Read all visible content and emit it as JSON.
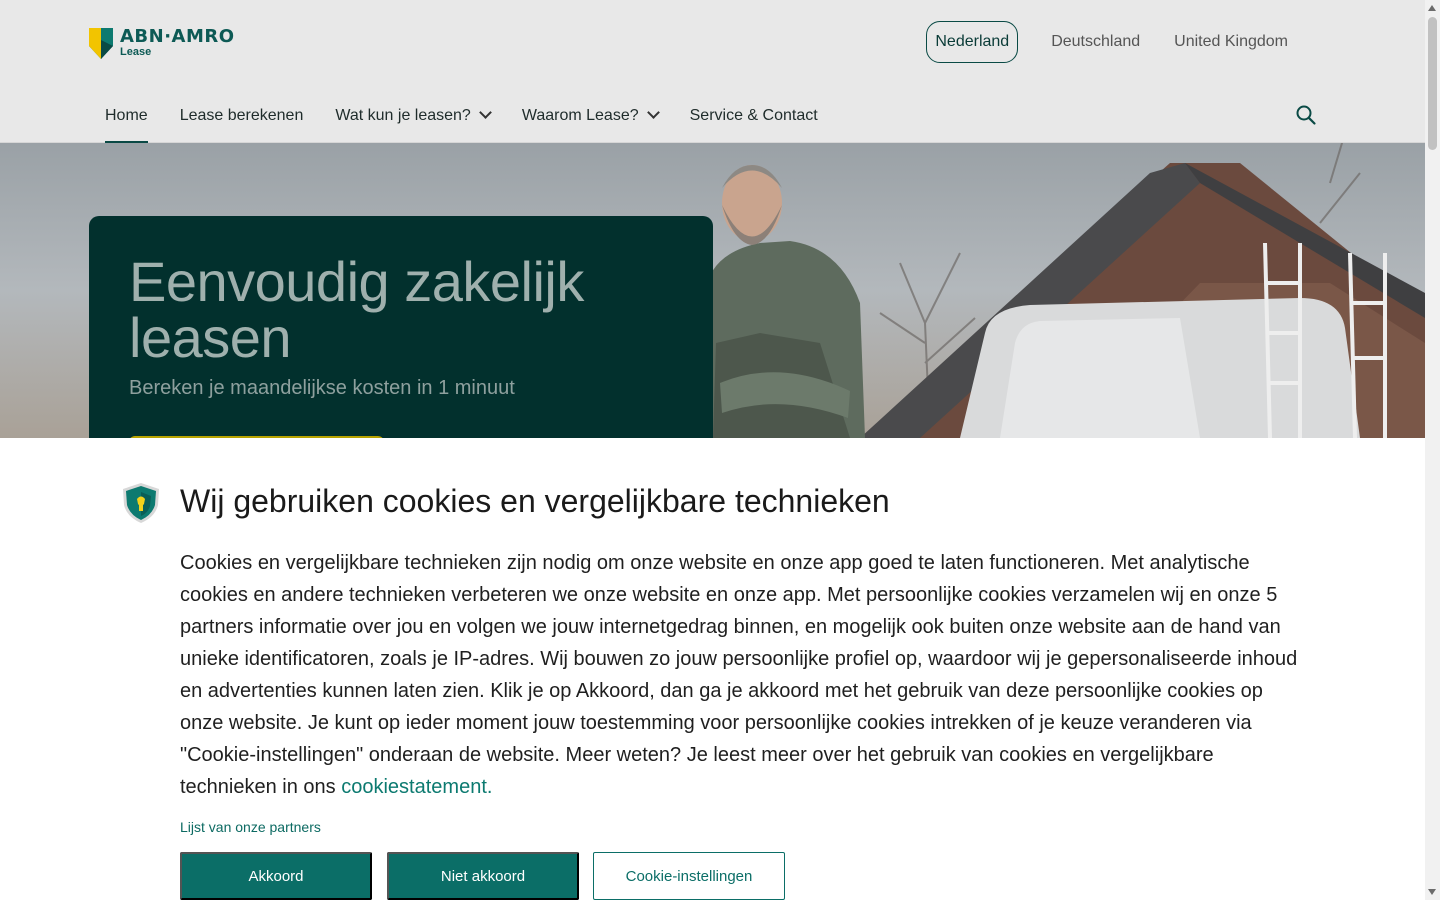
{
  "brand": {
    "name": "ABN·AMRO",
    "sub": "Lease"
  },
  "countries": [
    {
      "label": "Nederland",
      "active": true
    },
    {
      "label": "Deutschland",
      "active": false
    },
    {
      "label": "United Kingdom",
      "active": false
    }
  ],
  "nav": {
    "items": [
      {
        "label": "Home",
        "active": true,
        "dropdown": false
      },
      {
        "label": "Lease berekenen",
        "active": false,
        "dropdown": false
      },
      {
        "label": "Wat kun je leasen?",
        "active": false,
        "dropdown": true
      },
      {
        "label": "Waarom Lease?",
        "active": false,
        "dropdown": true
      },
      {
        "label": "Service & Contact",
        "active": false,
        "dropdown": false
      }
    ],
    "search_icon": "search-icon"
  },
  "hero": {
    "title": "Eenvoudig zakelijk leasen",
    "subtitle": "Bereken je maandelijkse kosten in 1 minuut"
  },
  "cookie": {
    "icon": "shield-icon",
    "title": "Wij gebruiken cookies en vergelijkbare technieken",
    "body": "Cookies en vergelijkbare technieken zijn nodig om onze website en onze app goed te laten functioneren. Met analytische cookies en andere technieken verbeteren we onze website en onze app. Met persoonlijke cookies verzamelen wij en onze 5 partners informatie over jou en volgen we jouw internetgedrag binnen, en mogelijk ook buiten onze website aan de hand van unieke identificatoren, zoals je IP-adres. Wij bouwen zo jouw persoonlijke profiel op, waardoor wij je gepersonaliseerde inhoud en advertenties kunnen laten zien. Klik je op Akkoord, dan ga je akkoord met het gebruik van deze persoonlijke cookies op onze website. Je kunt op ieder moment jouw toestemming voor persoonlijke cookies intrekken of je keuze veranderen via \"Cookie-instellingen\" onderaan de website. Meer weten? Je leest meer over het gebruik van cookies en vergelijkbare technieken in ons ",
    "statement_link": "cookiestatement.",
    "partners_link": "Lijst van onze partners",
    "accept_label": "Akkoord",
    "decline_label": "Niet akkoord",
    "settings_label": "Cookie-instellingen"
  },
  "colors": {
    "primary": "#0b6e67",
    "hero_card": "#02302d",
    "header_bg": "#e8e8e8",
    "cta": "#b8a300"
  }
}
